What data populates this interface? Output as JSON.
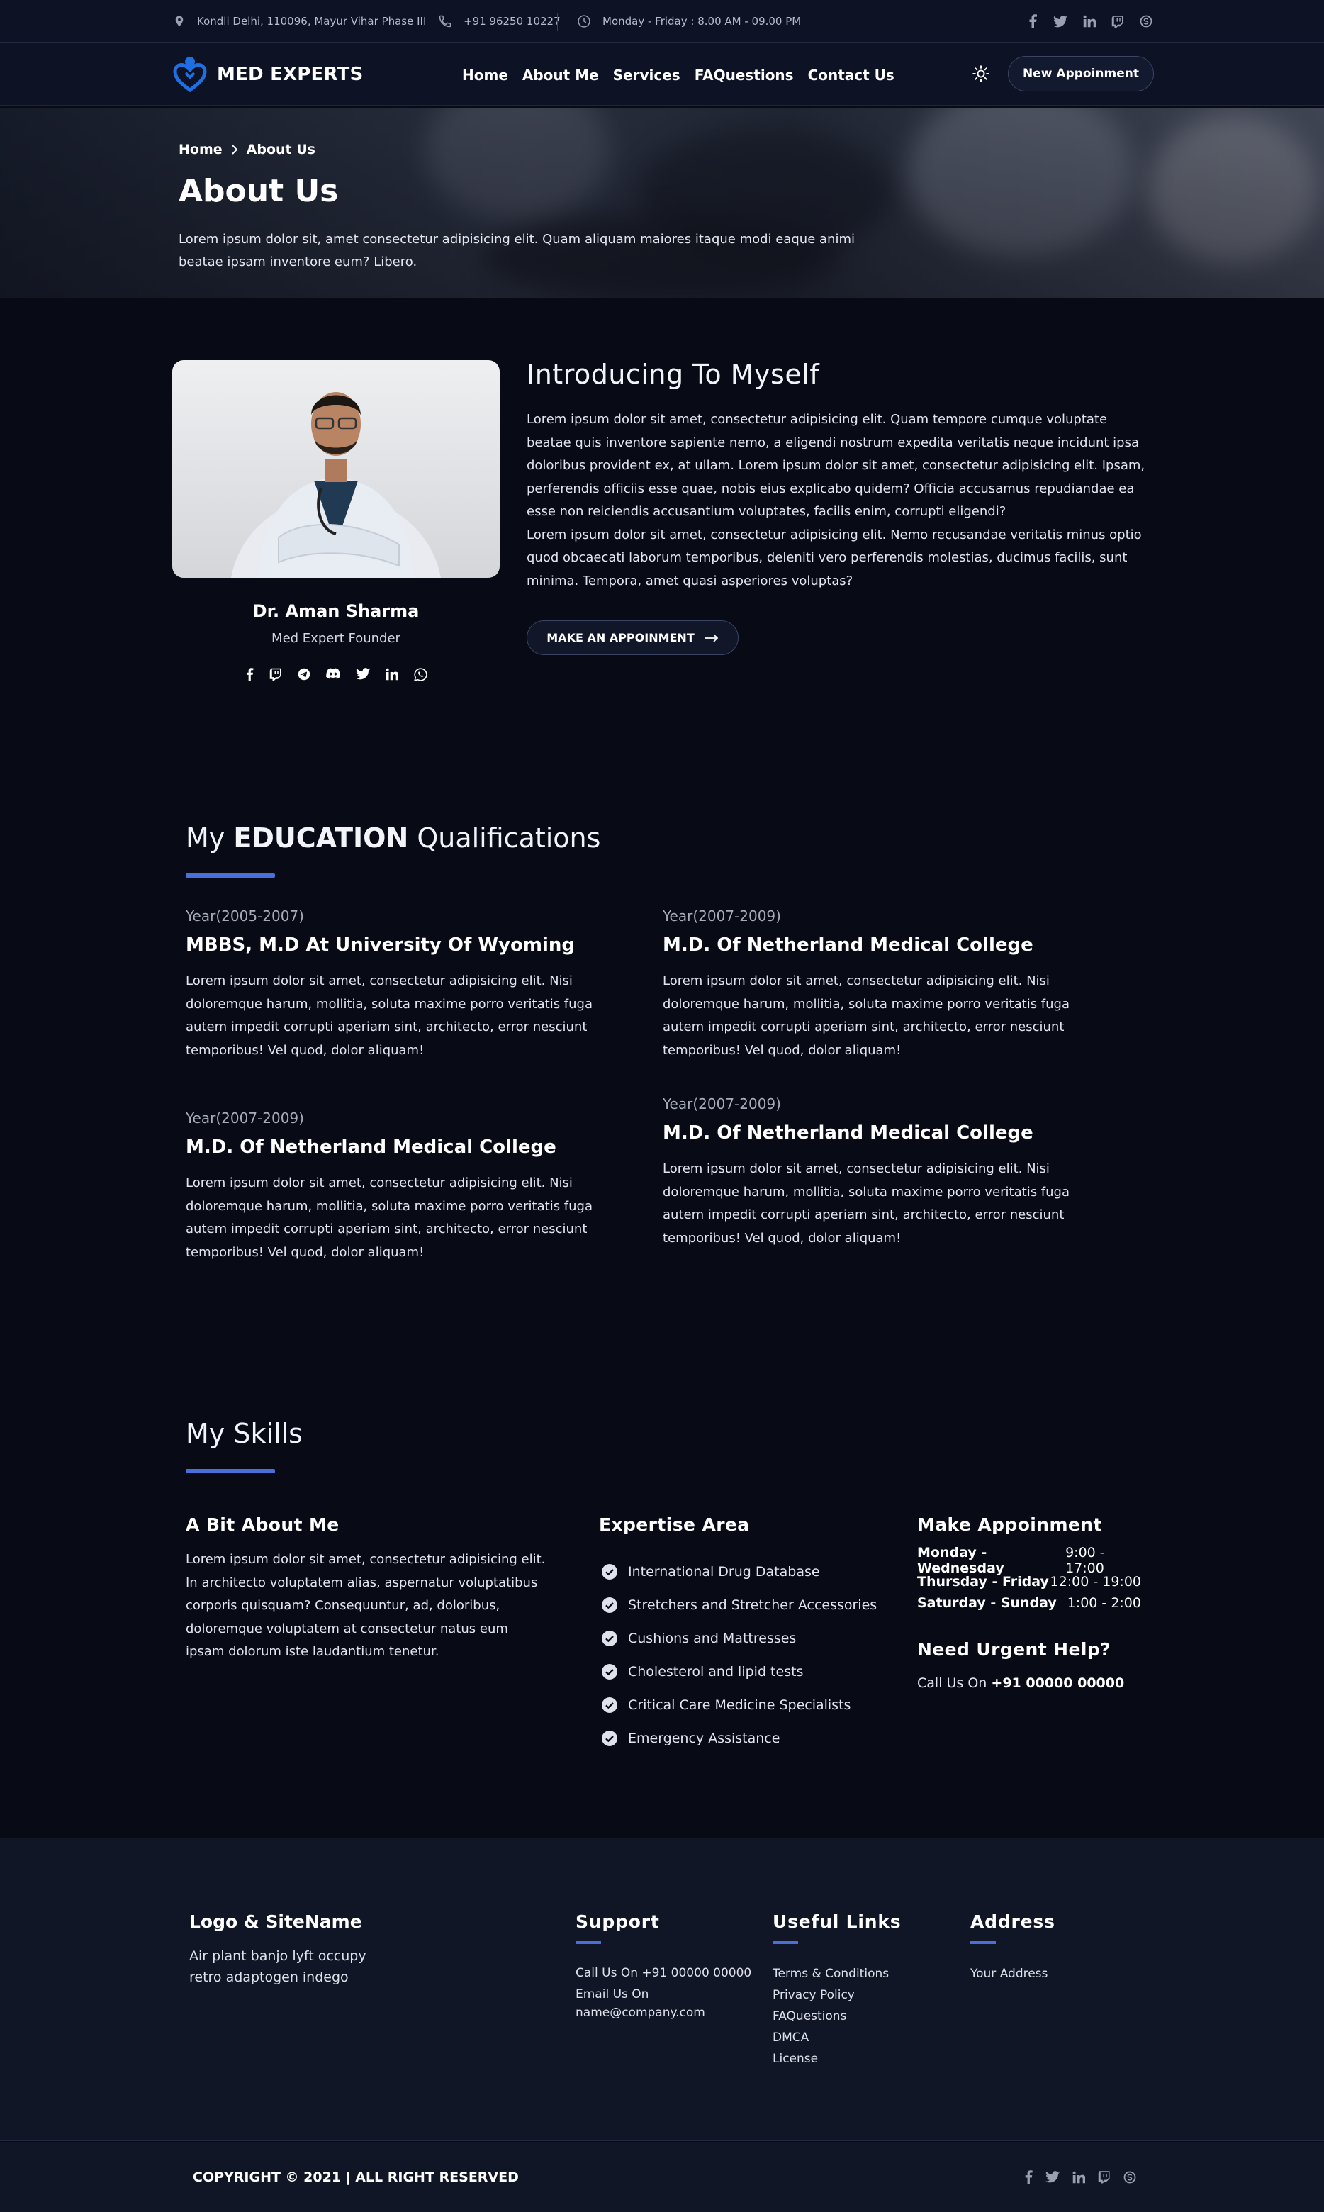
{
  "topbar": {
    "address": "Kondli Delhi, 110096, Mayur Vihar Phase III",
    "phone": "+91 96250 10227",
    "hours": "Monday - Friday : 8.00 AM - 09.00 PM",
    "social_icons": [
      "facebook-icon",
      "twitter-icon",
      "linkedin-icon",
      "twitch-icon",
      "skype-icon"
    ]
  },
  "nav": {
    "brand": "MED EXPERTS",
    "links": [
      "Home",
      "About Me",
      "Services",
      "FAQuestions",
      "Contact Us"
    ],
    "cta": "New Appoinment"
  },
  "hero": {
    "breadcrumb": [
      "Home",
      "About Us"
    ],
    "title": "About Us",
    "text": "Lorem ipsum dolor sit, amet consectetur adipisicing elit. Quam aliquam maiores itaque modi eaque animi beatae ipsam inventore eum? Libero."
  },
  "intro": {
    "doctor_name": "Dr. Aman Sharma",
    "doctor_role": "Med Expert Founder",
    "social_icons": [
      "facebook-icon",
      "twitch-icon",
      "telegram-icon",
      "discord-icon",
      "twitter-icon",
      "linkedin-icon",
      "whatsapp-icon"
    ],
    "title": "Introducing To Myself",
    "para1": "Lorem ipsum dolor sit amet, consectetur adipisicing elit. Quam tempore cumque voluptate beatae quis inventore sapiente nemo, a eligendi nostrum expedita veritatis neque incidunt ipsa doloribus provident ex, at ullam. Lorem ipsum dolor sit amet, consectetur adipisicing elit. Ipsam, perferendis officiis esse quae, nobis eius explicabo quidem? Officia accusamus repudiandae ea esse non reiciendis accusantium voluptates, facilis enim, corrupti eligendi?",
    "para2": "Lorem ipsum dolor sit amet, consectetur adipisicing elit. Nemo recusandae veritatis minus optio quod obcaecati laborum temporibus, deleniti vero perferendis molestias, ducimus facilis, sunt minima. Tempora, amet quasi asperiores voluptas?",
    "button": "MAKE AN APPOINMENT"
  },
  "education": {
    "title_pre": "My",
    "title_bold": "EDUCATION",
    "title_post": "Qualifications",
    "items": [
      {
        "year": "Year(2005-2007)",
        "degree": "MBBS, M.D At University Of Wyoming",
        "text": "Lorem ipsum dolor sit amet, consectetur adipisicing elit. Nisi doloremque harum, mollitia, soluta maxime porro veritatis fuga autem impedit corrupti aperiam sint, architecto, error nesciunt temporibus! Vel quod, dolor aliquam!"
      },
      {
        "year": "Year(2007-2009)",
        "degree": "M.D. Of Netherland Medical College",
        "text": "Lorem ipsum dolor sit amet, consectetur adipisicing elit. Nisi doloremque harum, mollitia, soluta maxime porro veritatis fuga autem impedit corrupti aperiam sint, architecto, error nesciunt temporibus! Vel quod, dolor aliquam!"
      },
      {
        "year": "Year(2007-2009)",
        "degree": "M.D. Of Netherland Medical College",
        "text": "Lorem ipsum dolor sit amet, consectetur adipisicing elit. Nisi doloremque harum, mollitia, soluta maxime porro veritatis fuga autem impedit corrupti aperiam sint, architecto, error nesciunt temporibus! Vel quod, dolor aliquam!"
      },
      {
        "year": "Year(2007-2009)",
        "degree": "M.D. Of Netherland Medical College",
        "text": "Lorem ipsum dolor sit amet, consectetur adipisicing elit. Nisi doloremque harum, mollitia, soluta maxime porro veritatis fuga autem impedit corrupti aperiam sint, architecto, error nesciunt temporibus! Vel quod, dolor aliquam!"
      }
    ]
  },
  "skills": {
    "title": "My Skills",
    "about_heading": "A Bit About Me",
    "about_text": "Lorem ipsum dolor sit amet, consectetur adipisicing elit. In architecto voluptatem alias, aspernatur voluptatibus corporis quisquam? Consequuntur, ad, doloribus, doloremque voluptatem at consectetur natus eum ipsam dolorum iste laudantium tenetur.",
    "expertise_heading": "Expertise Area",
    "expertise": [
      "International Drug Database",
      "Stretchers and Stretcher Accessories",
      "Cushions and Mattresses",
      "Cholesterol and lipid tests",
      "Critical Care Medicine Specialists",
      "Emergency Assistance"
    ],
    "appointment_heading": "Make Appoinment",
    "hours": [
      {
        "day": "Monday - Wednesday",
        "time": "9:00 - 17:00"
      },
      {
        "day": "Thursday - Friday",
        "time": "12:00 - 19:00"
      },
      {
        "day": "Saturday - Sunday",
        "time": "1:00 - 2:00"
      }
    ],
    "urgent_heading": "Need Urgent Help?",
    "call_prefix": "Call Us On",
    "call_number": "+91 00000 00000"
  },
  "footer": {
    "logo_heading": "Logo & SiteName",
    "tagline": "Air plant banjo lyft occupy retro adaptogen indego",
    "support_heading": "Support",
    "support_call": "Call Us On +91 00000 00000",
    "support_email_label": "Email Us On",
    "support_email": "name@company.com",
    "links_heading": "Useful Links",
    "links": [
      "Terms & Conditions",
      "Privacy Policy",
      "FAQuestions",
      "DMCA",
      "License"
    ],
    "address_heading": "Address",
    "address": "Your Address",
    "copyright": "COPYRIGHT © 2021 | ALL RIGHT RESERVED",
    "social_icons": [
      "facebook-icon",
      "twitter-icon",
      "linkedin-icon",
      "twitch-icon",
      "skype-icon"
    ]
  },
  "colors": {
    "background": "#080b16",
    "panel": "#0d1224",
    "footer": "#111627",
    "accent": "#4a6fd8",
    "brand": "#1f6fe0"
  }
}
